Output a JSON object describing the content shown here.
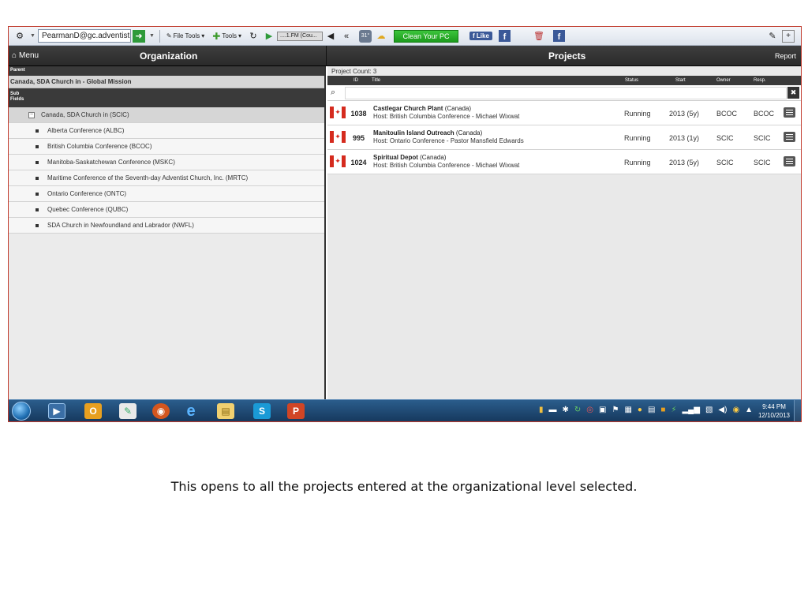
{
  "toolbar": {
    "account": "PearmanD@gc.adventist",
    "file_tools": "File Tools",
    "tools": "Tools",
    "radio": "....1.FM (Cou...",
    "weather": "31°",
    "clean_pc": "Clean Your PC",
    "like": "Like"
  },
  "header": {
    "menu": "Menu",
    "organization_title": "Organization",
    "projects_title": "Projects",
    "report": "Report"
  },
  "left": {
    "parent_label": "Parent",
    "parent_value": "Canada, SDA Church in - Global Mission",
    "sub_label_1": "Sub",
    "sub_label_2": "Fields",
    "root": {
      "toggle": "−",
      "label": "Canada, SDA Church in (SCIC)"
    },
    "children": [
      "Alberta Conference (ALBC)",
      "British Columbia Conference (BCOC)",
      "Manitoba-Saskatchewan Conference (MSKC)",
      "Maritime Conference of the Seventh-day Adventist Church, Inc. (MRTC)",
      "Ontario Conference (ONTC)",
      "Quebec Conference (QUBC)",
      "SDA Church in Newfoundland and Labrador (NWFL)"
    ]
  },
  "projects": {
    "count": "Project Count: 3",
    "columns": {
      "id": "ID",
      "title": "Title",
      "status": "Status",
      "start": "Start",
      "owner": "Owner",
      "resp": "Resp."
    },
    "rows": [
      {
        "id": "1038",
        "name": "Castlegar Church Plant",
        "country": " (Canada)",
        "host": "Host: British Columbia Conference - Michael Wixwat",
        "status": "Running",
        "start": "2013 (5y)",
        "owner": "BCOC",
        "resp": "BCOC"
      },
      {
        "id": "995",
        "name": "Manitoulin Island Outreach",
        "country": " (Canada)",
        "host": "Host: Ontario Conference - Pastor Mansfield Edwards",
        "status": "Running",
        "start": "2013 (1y)",
        "owner": "SCIC",
        "resp": "SCIC"
      },
      {
        "id": "1024",
        "name": "Spiritual Depot",
        "country": " (Canada)",
        "host": "Host: British Columbia Conference - Michael Wixwat",
        "status": "Running",
        "start": "2013 (5y)",
        "owner": "SCIC",
        "resp": "SCIC"
      }
    ]
  },
  "taskbar": {
    "time": "9:44 PM",
    "date": "12/10/2013"
  },
  "caption": "This opens to all the projects entered at the organizational level selected.",
  "colors": {
    "accent_green": "#1c9a1c",
    "facebook": "#3b5998",
    "header_dark": "#2a2a2a",
    "taskbar": "#16395e",
    "flag_red": "#d52b1e"
  }
}
